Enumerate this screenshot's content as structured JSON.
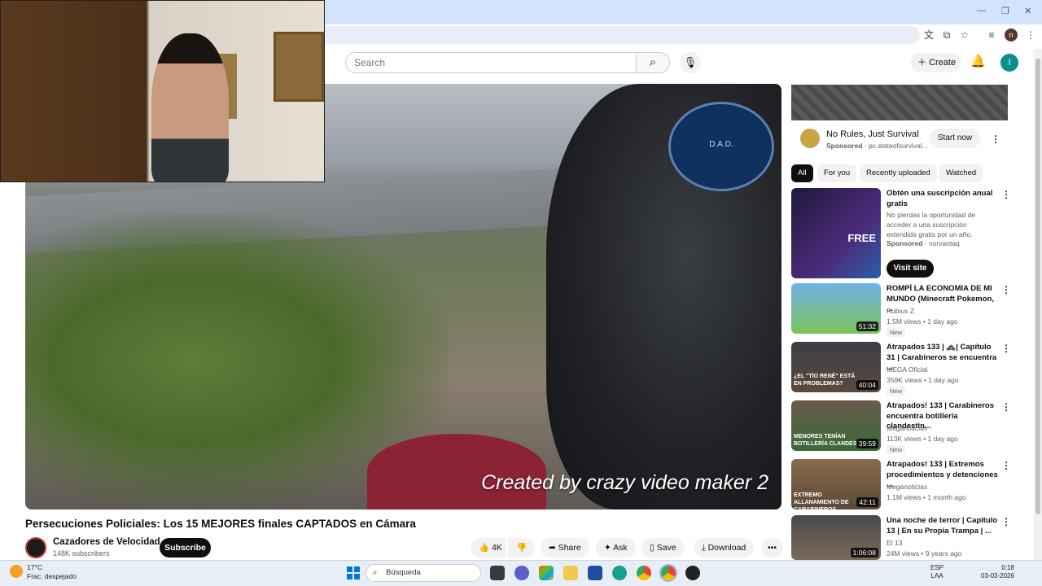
{
  "search": {
    "placeholder": "Search"
  },
  "header": {
    "create_label": "Create",
    "avatar_letter": "I"
  },
  "video": {
    "watermark": "Created by crazy video maker 2",
    "badge_text": "D.A.D."
  },
  "watch": {
    "title": "Persecuciones Policiales: Los 15 MEJORES finales CAPTADOS en Cámara",
    "channel": "Cazadores de Velocidad",
    "subscribers": "148K subscribers",
    "subscribe_label": "Subscribe",
    "likes": "4K",
    "share_label": "Share",
    "ask_label": "Ask",
    "save_label": "Save",
    "download_label": "Download"
  },
  "ad": {
    "title": "No Rules, Just Survival",
    "sponsor": "Sponsored",
    "domain": "pc.stateofsurvival...",
    "cta": "Start now"
  },
  "chips": [
    "All",
    "For you",
    "Recently uploaded",
    "Watched"
  ],
  "sidebar_ad": {
    "title": "Obtén una suscripción anual gratis",
    "desc": "No pierdas la oportunidad de acceder a una suscripción extendida gratis por un año.",
    "sponsor": "Sponsored",
    "advertiser": "norvantaq",
    "cta": "Visit site",
    "thumb_text": "FREE"
  },
  "videos": [
    {
      "title": "ROMPÍ LA ECONOMIA DE MI MUNDO (Minecraft Pokemon, ...",
      "channel": "Rubius Z",
      "meta": "1.5M views • 1 day ago",
      "new": "New",
      "duration": "51:32"
    },
    {
      "title": "Atrapados 133 | 🚓| Capítulo 31 | Carabineros se encuentra ...",
      "channel": "MEGA Oficial",
      "meta": "359K views • 1 day ago",
      "new": "New",
      "duration": "40:04",
      "thumb_text": "¿EL \"TÍO RENÉ\" ESTÁ EN PROBLEMAS?"
    },
    {
      "title": "Atrapados! 133 | Carabineros encuentra botillería clandestin...",
      "channel": "Meganoticias",
      "meta": "113K views • 1 day ago",
      "new": "New",
      "duration": "39:59",
      "thumb_text": "MENORES TENÍAN BOTILLERÍA CLANDES"
    },
    {
      "title": "Atrapados! 133 | Extremos procedimientos y detenciones ...",
      "channel": "Meganoticias",
      "meta": "1.1M views • 1 month ago",
      "new": "",
      "duration": "42:11",
      "thumb_text": "EXTREMO ALLANAMIENTO DE CARABINEROS"
    },
    {
      "title": "Una noche de terror | Capítulo 13 | En su Propia Trampa | ...",
      "channel": "El 13",
      "meta": "24M views • 9 years ago",
      "new": "",
      "duration": "1:06:08"
    }
  ],
  "taskbar": {
    "temp": "17°C",
    "weather": "Frac. despejado",
    "search": "Búsqueda",
    "lang1": "ESP",
    "lang2": "LAA",
    "time": "0:18",
    "date": "03-03-2026"
  },
  "colors": {
    "accent": "#0f0f0f",
    "avatar": "#0a8f8f",
    "tabstrip": "#d3e3fd"
  }
}
